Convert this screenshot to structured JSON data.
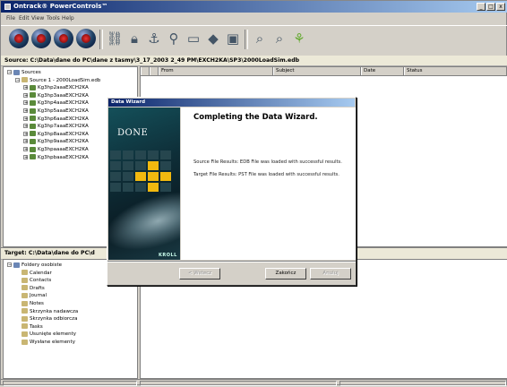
{
  "app": {
    "title": "Ontrack® PowerControls™",
    "window_buttons": [
      "_",
      "□",
      "x"
    ]
  },
  "menu": [
    "File",
    "Edit",
    "View",
    "Tools",
    "Help"
  ],
  "toolbar": {
    "icons": [
      "open-source-icon",
      "open-target-icon",
      "save-icon",
      "disconnect-icon",
      "network-icon",
      "lock-icon",
      "anchor-icon",
      "search-icon",
      "document-icon",
      "filter-icon",
      "properties-icon",
      "find-icon",
      "find-next-icon",
      "copy-icon"
    ]
  },
  "source": {
    "path_label": "Source: C:\\Data\\dane do PC\\dane z tasmy\\3_17_2003 2_49 PM\\EXCH2KA\\SP3\\2000LoadSim.edb",
    "tree": [
      {
        "label": "Sources",
        "depth": 0
      },
      {
        "label": "Source 1 - 2000LoadSim.edb",
        "depth": 1
      },
      {
        "label": "Kg3hp2aaaEXCH2KA",
        "depth": 2
      },
      {
        "label": "Kg3hp3aaaEXCH2KA",
        "depth": 2
      },
      {
        "label": "Kg3hp4aaaEXCH2KA",
        "depth": 2
      },
      {
        "label": "Kg3hp5aaaEXCH2KA",
        "depth": 2
      },
      {
        "label": "Kg3hp6aaaEXCH2KA",
        "depth": 2
      },
      {
        "label": "Kg3hp7aaaEXCH2KA",
        "depth": 2
      },
      {
        "label": "Kg3hp8aaaEXCH2KA",
        "depth": 2
      },
      {
        "label": "Kg3hp9aaaEXCH2KA",
        "depth": 2
      },
      {
        "label": "Kg3hpaaaaEXCH2KA",
        "depth": 2
      },
      {
        "label": "Kg3hpbaaaEXCH2KA",
        "depth": 2
      }
    ],
    "columns": [
      "",
      "",
      "From",
      "Subject",
      "Date",
      "Status"
    ]
  },
  "target": {
    "path_label": "Target: C:\\Data\\dane do PC\\d",
    "tree": [
      {
        "label": "Foldery osobiste",
        "depth": 0
      },
      {
        "label": "Calendar",
        "depth": 1
      },
      {
        "label": "Contacts",
        "depth": 1
      },
      {
        "label": "Drafts",
        "depth": 1
      },
      {
        "label": "Journal",
        "depth": 1
      },
      {
        "label": "Notes",
        "depth": 1
      },
      {
        "label": "Skrzynka nadawcza",
        "depth": 1
      },
      {
        "label": "Skrzynka odbiorcza",
        "depth": 1
      },
      {
        "label": "Tasks",
        "depth": 1
      },
      {
        "label": "Usunięte elementy",
        "depth": 1
      },
      {
        "label": "Wysłane elementy",
        "depth": 1
      }
    ]
  },
  "dialog": {
    "title": "Data Wizard",
    "image_text": "DONE",
    "brand": "KROLL",
    "heading": "Completing the Data Wizard.",
    "source_result": "Source File Results: EDB File was loaded with successful results.",
    "target_result": "Target File Results: PST File was loaded with successful results.",
    "buttons": {
      "back": "< Wstecz",
      "finish": "Zakończ",
      "cancel": "Anuluj"
    }
  },
  "colors": {
    "title_gradient_start": "#0a246a",
    "title_gradient_end": "#a6caf0",
    "accent_yellow": "#f2b90f",
    "dialog_image_bg": "#0e2e38"
  }
}
